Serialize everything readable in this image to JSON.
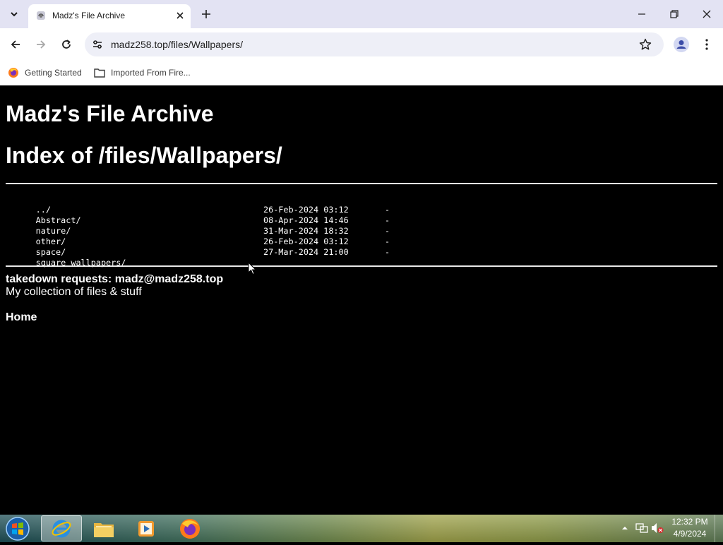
{
  "browser": {
    "tab_title": "Madz's File Archive",
    "url": "madz258.top/files/Wallpapers/",
    "bookmarks": [
      {
        "label": "Getting Started",
        "icon": "firefox-icon"
      },
      {
        "label": "Imported From Fire...",
        "icon": "folder-icon"
      }
    ]
  },
  "page": {
    "site_title": "Madz's File Archive",
    "index_heading": "Index of /files/Wallpapers/",
    "parent_link": "../",
    "entries": [
      {
        "name": "Abstract/",
        "date": "26-Feb-2024 03:12",
        "size": "-"
      },
      {
        "name": "nature/",
        "date": "08-Apr-2024 14:46",
        "size": "-"
      },
      {
        "name": "other/",
        "date": "31-Mar-2024 18:32",
        "size": "-"
      },
      {
        "name": "space/",
        "date": "26-Feb-2024 03:12",
        "size": "-"
      },
      {
        "name": "square wallpapers/",
        "date": "27-Mar-2024 21:00",
        "size": "-"
      }
    ],
    "takedown": "takedown requests: madz@madz258.top",
    "tagline": "My collection of files & stuff",
    "home_link": "Home"
  },
  "taskbar": {
    "items": [
      "internet-explorer-icon",
      "file-explorer-icon",
      "media-player-icon",
      "firefox-icon"
    ],
    "time": "12:32 PM",
    "date": "4/9/2024"
  }
}
